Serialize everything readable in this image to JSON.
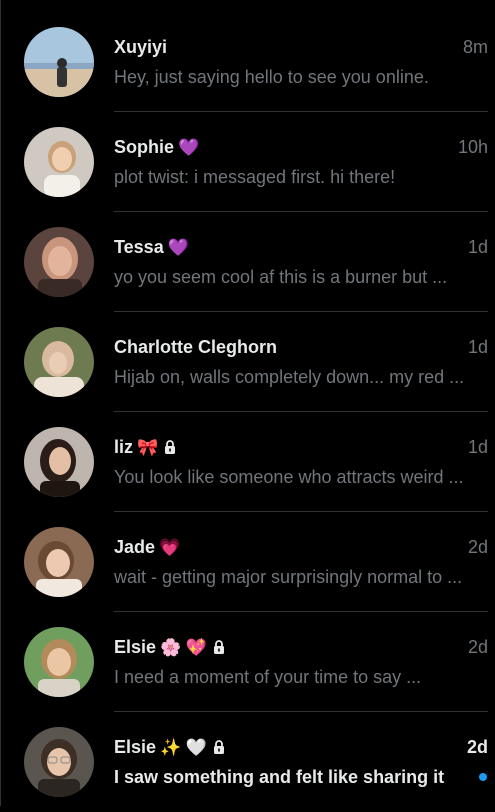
{
  "conversations": [
    {
      "name": "Xuyiyi",
      "emojis": "",
      "locked": false,
      "time": "8m",
      "preview": "Hey, just saying hello to see you online.",
      "unread": false,
      "avatar_colors": [
        "#9fc3e0",
        "#f2d6b8",
        "#2b2b2b"
      ]
    },
    {
      "name": "Sophie",
      "emojis": "💜",
      "locked": false,
      "time": "10h",
      "preview": "plot twist: i messaged first. hi there!",
      "unread": false,
      "avatar_colors": [
        "#d9d4cf",
        "#e8c7a6",
        "#3b2f2a"
      ]
    },
    {
      "name": "Tessa",
      "emojis": "💜",
      "locked": false,
      "time": "1d",
      "preview": "yo you seem cool af this is a burner but ...",
      "unread": false,
      "avatar_colors": [
        "#6b4e46",
        "#d8a891",
        "#2a1e1b"
      ]
    },
    {
      "name": "Charlotte Cleghorn",
      "emojis": "",
      "locked": false,
      "time": "1d",
      "preview": "Hijab on, walls completely down... my red ...",
      "unread": false,
      "avatar_colors": [
        "#7c8a5c",
        "#e8d8c3",
        "#c9a58a"
      ]
    },
    {
      "name": "liz",
      "emojis": "🎀",
      "locked": true,
      "time": "1d",
      "preview": "You look like someone who attracts weird ...",
      "unread": false,
      "avatar_colors": [
        "#b8b0aa",
        "#e3bfa6",
        "#2a1c16"
      ]
    },
    {
      "name": "Jade",
      "emojis": "💗",
      "locked": false,
      "time": "2d",
      "preview": "wait - getting major surprisingly normal to ...",
      "unread": false,
      "avatar_colors": [
        "#a07a5e",
        "#e9c6ad",
        "#6b4a35"
      ]
    },
    {
      "name": "Elsie",
      "emojis": "🌸 💖",
      "locked": true,
      "time": "2d",
      "preview": "I need a moment of your time to say ...",
      "unread": false,
      "avatar_colors": [
        "#7fae6a",
        "#eac6a5",
        "#b38a5a"
      ]
    },
    {
      "name": "Elsie",
      "emojis": "✨ 🤍",
      "locked": true,
      "time": "2d",
      "preview": "I saw something and felt like sharing it",
      "unread": true,
      "avatar_colors": [
        "#5c5852",
        "#e6c5aa",
        "#3d2e26"
      ]
    }
  ],
  "colors": {
    "background": "#000000",
    "primary_text": "#e7e9ea",
    "secondary_text": "#71767b",
    "divider": "#2f3336",
    "unread_dot": "#1d9bf0"
  },
  "icons": {
    "lock": "lock-icon",
    "unread": "unread-dot-icon"
  }
}
